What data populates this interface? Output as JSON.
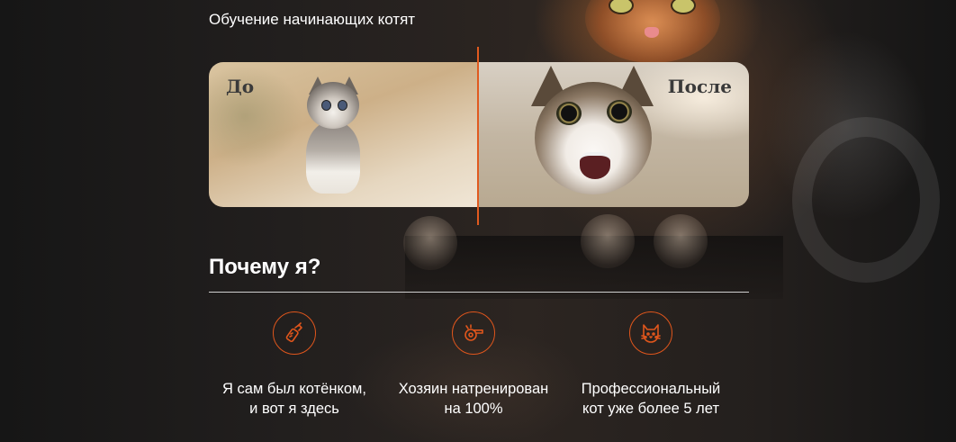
{
  "intro": {
    "title": "Обучение начинающих котят"
  },
  "comparison": {
    "before_label": "До",
    "after_label": "После",
    "accent_color": "#e05a1f"
  },
  "why": {
    "title": "Почему я?",
    "features": [
      {
        "icon": "baby-bottle-icon",
        "line1": "Я сам был котёнком,",
        "line2": "и вот я здесь"
      },
      {
        "icon": "whistle-icon",
        "line1": "Хозяин натренирован",
        "line2": "на 100%"
      },
      {
        "icon": "cat-face-icon",
        "line1": "Профессиональный",
        "line2": "кот уже более 5 лет"
      }
    ]
  }
}
